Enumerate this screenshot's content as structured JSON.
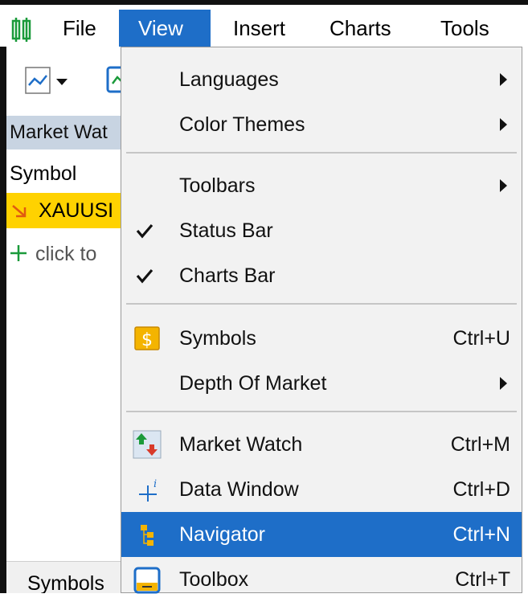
{
  "menubar": {
    "items": [
      {
        "label": "File"
      },
      {
        "label": "View"
      },
      {
        "label": "Insert"
      },
      {
        "label": "Charts"
      },
      {
        "label": "Tools"
      }
    ]
  },
  "market_watch": {
    "title": "Market Wat",
    "column_symbol": "Symbol",
    "rows": [
      {
        "symbol": "XAUUSI"
      }
    ],
    "add_hint": "click to"
  },
  "bottom_tabs": {
    "symbols": "Symbols"
  },
  "view_menu": {
    "items": [
      {
        "label": "Languages",
        "shortcut": "",
        "submenu": true
      },
      {
        "label": "Color Themes",
        "shortcut": "",
        "submenu": true
      },
      {
        "label": "Toolbars",
        "shortcut": "",
        "submenu": true
      },
      {
        "label": "Status Bar",
        "shortcut": "",
        "checked": true
      },
      {
        "label": "Charts Bar",
        "shortcut": "",
        "checked": true
      },
      {
        "label": "Symbols",
        "shortcut": "Ctrl+U",
        "icon": "dollar-icon"
      },
      {
        "label": "Depth Of Market",
        "shortcut": "",
        "submenu": true
      },
      {
        "label": "Market Watch",
        "shortcut": "Ctrl+M",
        "icon": "market-watch-icon"
      },
      {
        "label": "Data Window",
        "shortcut": "Ctrl+D",
        "icon": "crosshair-icon"
      },
      {
        "label": "Navigator",
        "shortcut": "Ctrl+N",
        "icon": "navigator-icon",
        "highlighted": true
      },
      {
        "label": "Toolbox",
        "shortcut": "Ctrl+T",
        "icon": "toolbox-icon"
      }
    ]
  },
  "colors": {
    "accent": "#1e6ec8",
    "selected_row": "#ffd200"
  }
}
